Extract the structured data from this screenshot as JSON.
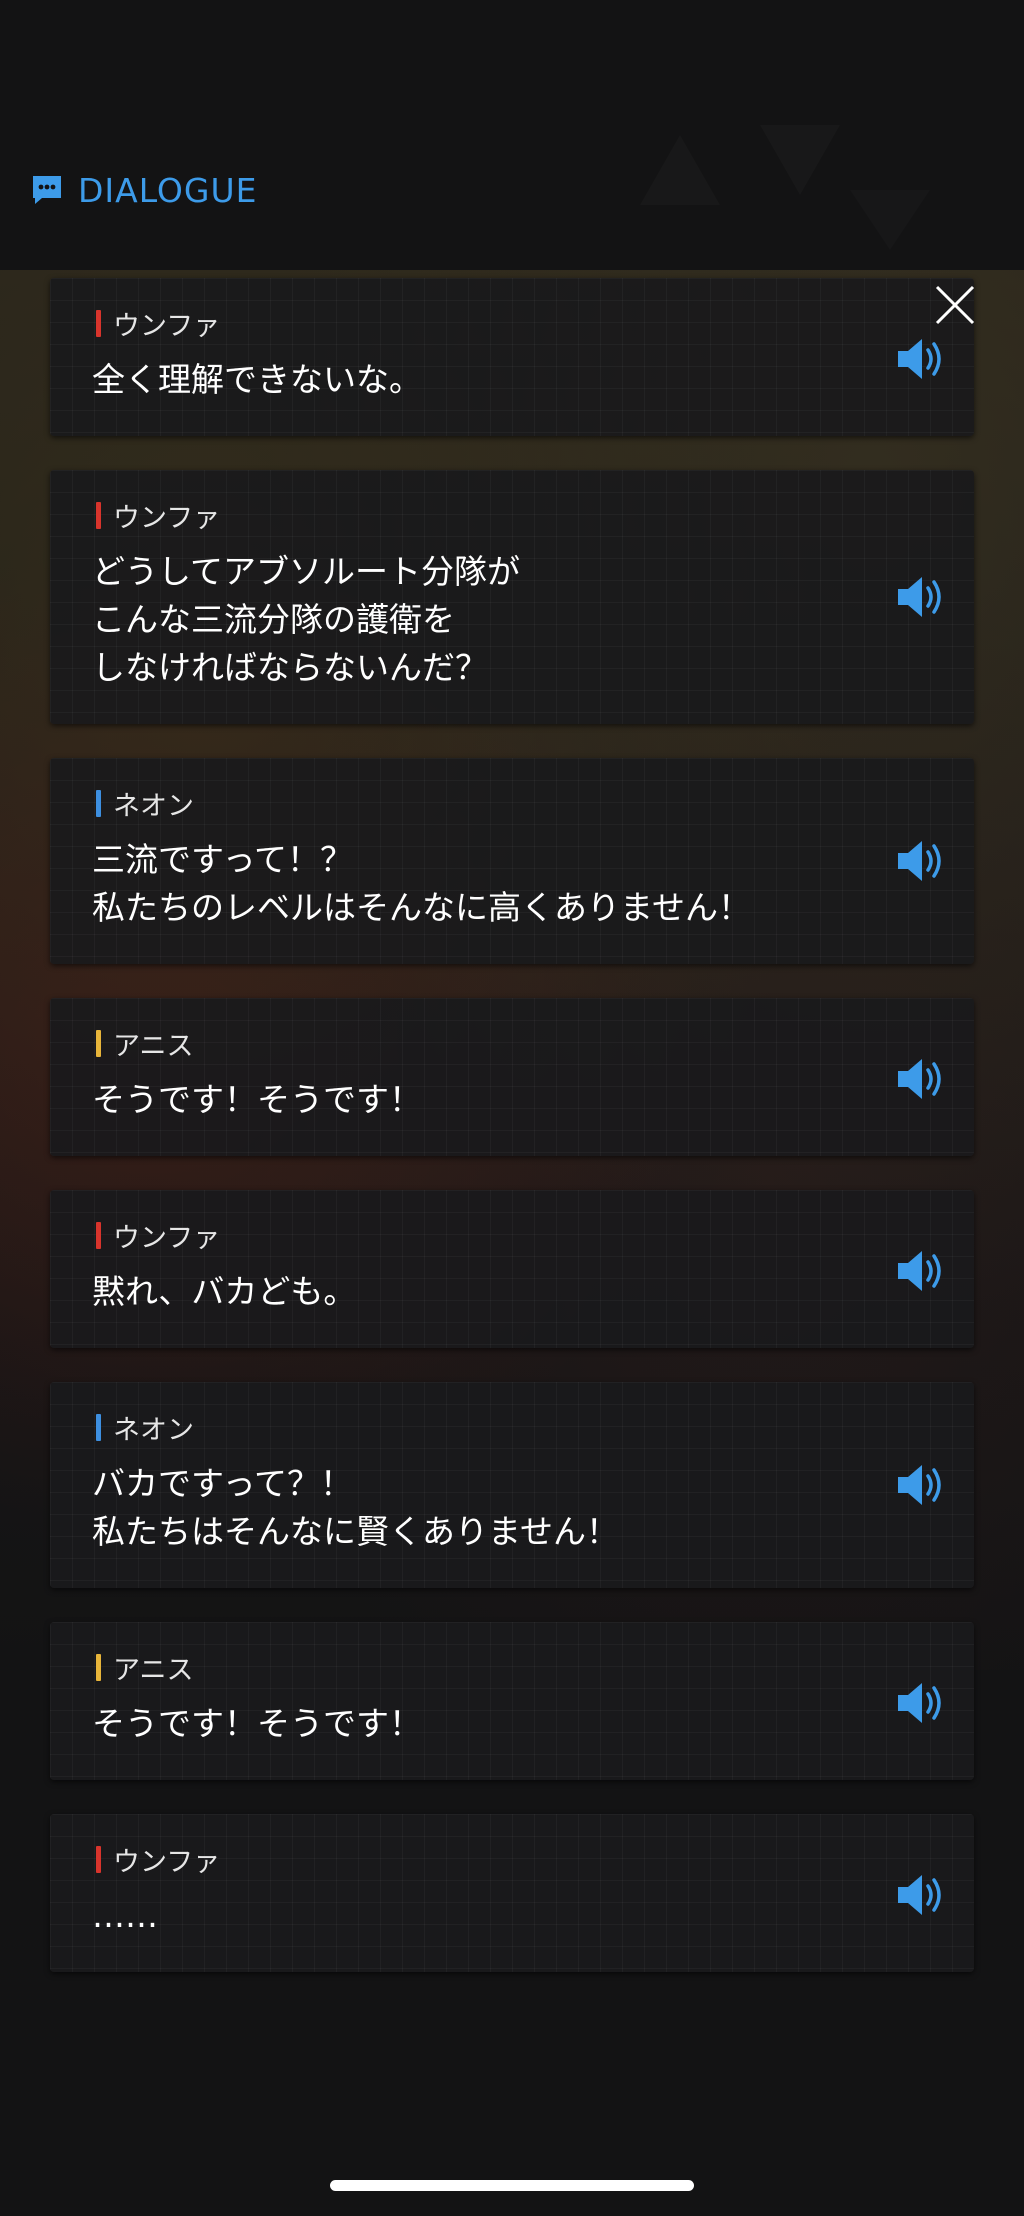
{
  "header": {
    "title": "DIALOGUE",
    "accent_color": "#3d9be9",
    "icon": "chat-bubble-icon"
  },
  "close": {
    "icon": "close-icon"
  },
  "speaker_colors": {
    "ウンファ": "#d8342c",
    "ネオン": "#3d8fe0",
    "アニス": "#e8b53a"
  },
  "dialogue": [
    {
      "speaker": "ウンファ",
      "text": "全く理解できないな。",
      "voice_icon": "speaker-icon"
    },
    {
      "speaker": "ウンファ",
      "text": "どうしてアブソルート分隊が\nこんな三流分隊の護衛を\nしなければならないんだ？",
      "voice_icon": "speaker-icon"
    },
    {
      "speaker": "ネオン",
      "text": "三流ですって！？\n私たちのレベルはそんなに高くありません！",
      "voice_icon": "speaker-icon"
    },
    {
      "speaker": "アニス",
      "text": "そうです！そうです！",
      "voice_icon": "speaker-icon"
    },
    {
      "speaker": "ウンファ",
      "text": "黙れ、バカども。",
      "voice_icon": "speaker-icon"
    },
    {
      "speaker": "ネオン",
      "text": "バカですって？！\n私たちはそんなに賢くありません！",
      "voice_icon": "speaker-icon"
    },
    {
      "speaker": "アニス",
      "text": "そうです！そうです！",
      "voice_icon": "speaker-icon"
    },
    {
      "speaker": "ウンファ",
      "text": "……",
      "voice_icon": "speaker-icon"
    }
  ],
  "voice_color": "#3d9be9"
}
